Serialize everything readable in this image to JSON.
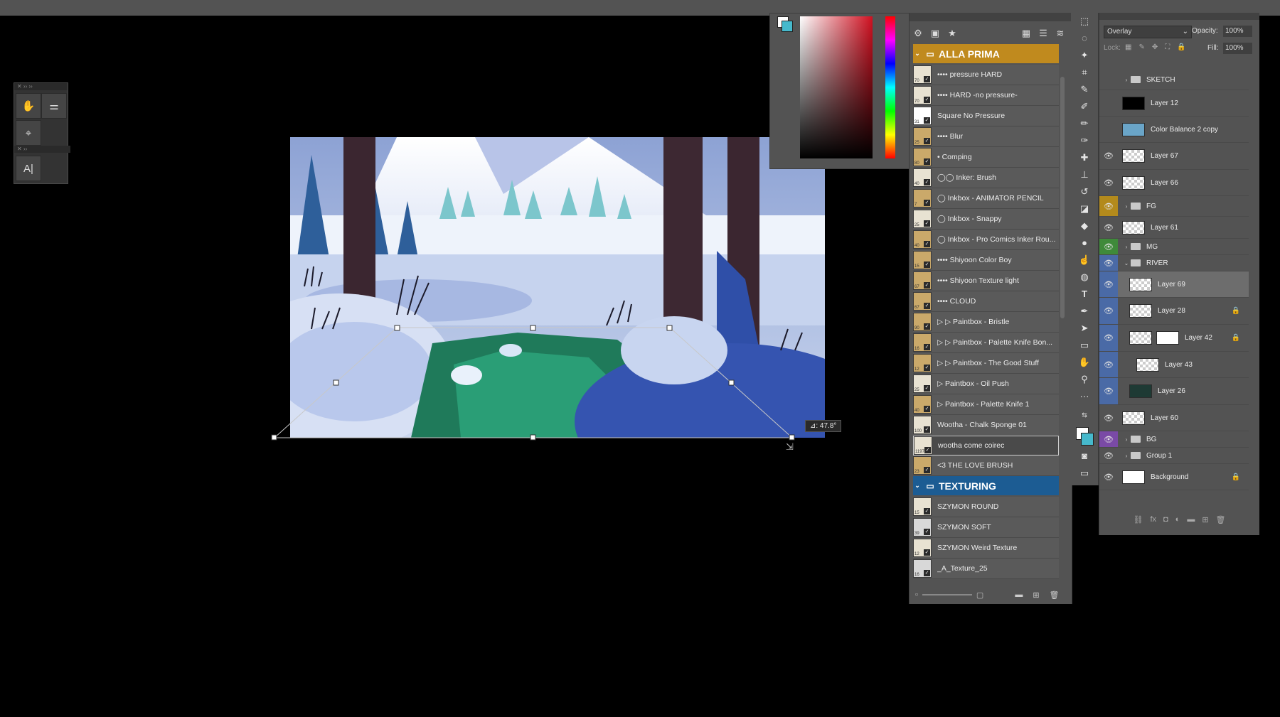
{
  "brushes": {
    "groups": [
      {
        "name": "ALLA PRIMA",
        "color": "#c08a1e",
        "items": [
          {
            "name": "•••• pressure HARD",
            "size": "70",
            "thumb": "#e8e2d2"
          },
          {
            "name": "•••• HARD -no pressure-",
            "size": "70",
            "thumb": "#e8e2d2"
          },
          {
            "name": "Square No Pressure",
            "size": "31",
            "thumb": "#ffffff"
          },
          {
            "name": "•••• Blur",
            "size": "25",
            "thumb": "#caa96a"
          },
          {
            "name": "• Comping",
            "size": "80",
            "thumb": "#caa96a"
          },
          {
            "name": "◯◯ Inker: Brush",
            "size": "40",
            "thumb": "#e8e2d2"
          },
          {
            "name": "◯ Inkbox - ANIMATOR PENCIL",
            "size": "7",
            "thumb": "#caa96a"
          },
          {
            "name": "◯ Inkbox - Snappy",
            "size": "25",
            "thumb": "#e8e2d2"
          },
          {
            "name": "◯ Inkbox - Pro Comics Inker Rou...",
            "size": "40",
            "thumb": "#caa96a"
          },
          {
            "name": "•••• Shiyoon Color Boy",
            "size": "15",
            "thumb": "#caa96a"
          },
          {
            "name": "•••• Shiyoon Texture light",
            "size": "67",
            "thumb": "#caa96a"
          },
          {
            "name": "•••• CLOUD",
            "size": "67",
            "thumb": "#caa96a"
          },
          {
            "name": "▷ ▷ Paintbox - Bristle",
            "size": "90",
            "thumb": "#caa96a"
          },
          {
            "name": "▷ ▷ Paintbox - Palette Knife Bon...",
            "size": "16",
            "thumb": "#caa96a"
          },
          {
            "name": "▷ ▷ Paintbox - The Good Stuff",
            "size": "12",
            "thumb": "#caa96a"
          },
          {
            "name": "▷ Paintbox - Oil Push",
            "size": "25",
            "thumb": "#e8e2d2"
          },
          {
            "name": "▷ Paintbox - Palette Knife 1",
            "size": "40",
            "thumb": "#caa96a"
          },
          {
            "name": "Wootha - Chalk Sponge 01",
            "size": "100",
            "thumb": "#e8e2d2"
          },
          {
            "name": "wootha come coirec",
            "size": "1197",
            "thumb": "#e8e2d2",
            "selected": true
          },
          {
            "name": "<3 THE LOVE BRUSH",
            "size": "23",
            "thumb": "#caa96a"
          }
        ]
      },
      {
        "name": "TEXTURING",
        "color": "#1c5c93",
        "items": [
          {
            "name": "SZYMON ROUND",
            "size": "15",
            "thumb": "#e8e2d2"
          },
          {
            "name": "SZYMON SOFT",
            "size": "39",
            "thumb": "#d8d8d8"
          },
          {
            "name": "SZYMON Weird Texture",
            "size": "12",
            "thumb": "#e8e2d2"
          },
          {
            "name": "_A_Texture_25",
            "size": "16",
            "thumb": "#d8d8d8"
          }
        ]
      }
    ]
  },
  "layers": {
    "blend_mode": "Overlay",
    "opacity_label": "Opacity:",
    "opacity_value": "100%",
    "lock_label": "Lock:",
    "fill_label": "Fill:",
    "fill_value": "100%",
    "items": [
      {
        "name": "SKETCH",
        "type": "group",
        "visible": false,
        "eye_color": "",
        "indent": 0,
        "h": 28
      },
      {
        "name": "Layer 12",
        "type": "layer",
        "visible": false,
        "eye_color": "",
        "thumb": "black",
        "indent": 0,
        "h": 36
      },
      {
        "name": "Color Balance 2 copy",
        "type": "layer",
        "visible": false,
        "eye_color": "",
        "thumb": "image",
        "indent": 0,
        "h": 36
      },
      {
        "name": "Layer 67",
        "type": "layer",
        "visible": true,
        "eye_color": "",
        "thumb": "checker",
        "indent": 0,
        "h": 37
      },
      {
        "name": "Layer 66",
        "type": "layer",
        "visible": true,
        "eye_color": "",
        "thumb": "checker",
        "indent": 0,
        "h": 36
      },
      {
        "name": "FG",
        "type": "group",
        "visible": true,
        "eye_color": "#b38a1c",
        "indent": 0,
        "h": 28
      },
      {
        "name": "Layer 61",
        "type": "layer",
        "visible": true,
        "eye_color": "",
        "thumb": "checker",
        "indent": 0,
        "h": 30
      },
      {
        "name": "MG",
        "type": "group",
        "visible": true,
        "eye_color": "#3f8a3a",
        "indent": 0,
        "h": 22
      },
      {
        "name": "RIVER",
        "type": "group",
        "visible": true,
        "eye_color": "#4a6aa6",
        "indent": 0,
        "open": true,
        "h": 22
      },
      {
        "name": "Layer 69",
        "type": "layer",
        "visible": true,
        "eye_color": "#4a6aa6",
        "thumb": "checker",
        "indent": 1,
        "selected": true,
        "h": 36
      },
      {
        "name": "Layer 28",
        "type": "layer",
        "visible": true,
        "eye_color": "#4a6aa6",
        "thumb": "checker",
        "indent": 1,
        "locked": true,
        "h": 37
      },
      {
        "name": "Layer 42",
        "type": "layer",
        "visible": true,
        "eye_color": "#4a6aa6",
        "thumb": "checker",
        "mask": true,
        "indent": 1,
        "locked": true,
        "h": 37
      },
      {
        "name": "Layer 43",
        "type": "layer",
        "visible": true,
        "eye_color": "#4a6aa6",
        "thumb": "checker",
        "indent": 2,
        "h": 36
      },
      {
        "name": "Layer 26",
        "type": "layer",
        "visible": true,
        "eye_color": "#4a6aa6",
        "thumb": "dark",
        "indent": 1,
        "h": 37
      },
      {
        "name": "Layer 60",
        "type": "layer",
        "visible": true,
        "eye_color": "",
        "thumb": "checker",
        "indent": 0,
        "h": 36
      },
      {
        "name": "BG",
        "type": "group",
        "visible": true,
        "eye_color": "#7a4aa6",
        "indent": 0,
        "h": 22
      },
      {
        "name": "Group 1",
        "type": "group",
        "visible": true,
        "eye_color": "",
        "indent": 0,
        "h": 22
      },
      {
        "name": "Background",
        "type": "layer",
        "visible": true,
        "eye_color": "",
        "thumb": "white",
        "indent": 0,
        "locked": true,
        "h": 36
      }
    ]
  },
  "canvas": {
    "transform_angle": "⊿: 47.8°"
  },
  "colors": {
    "foreground": "#ffffff",
    "background": "#46b9cc"
  }
}
